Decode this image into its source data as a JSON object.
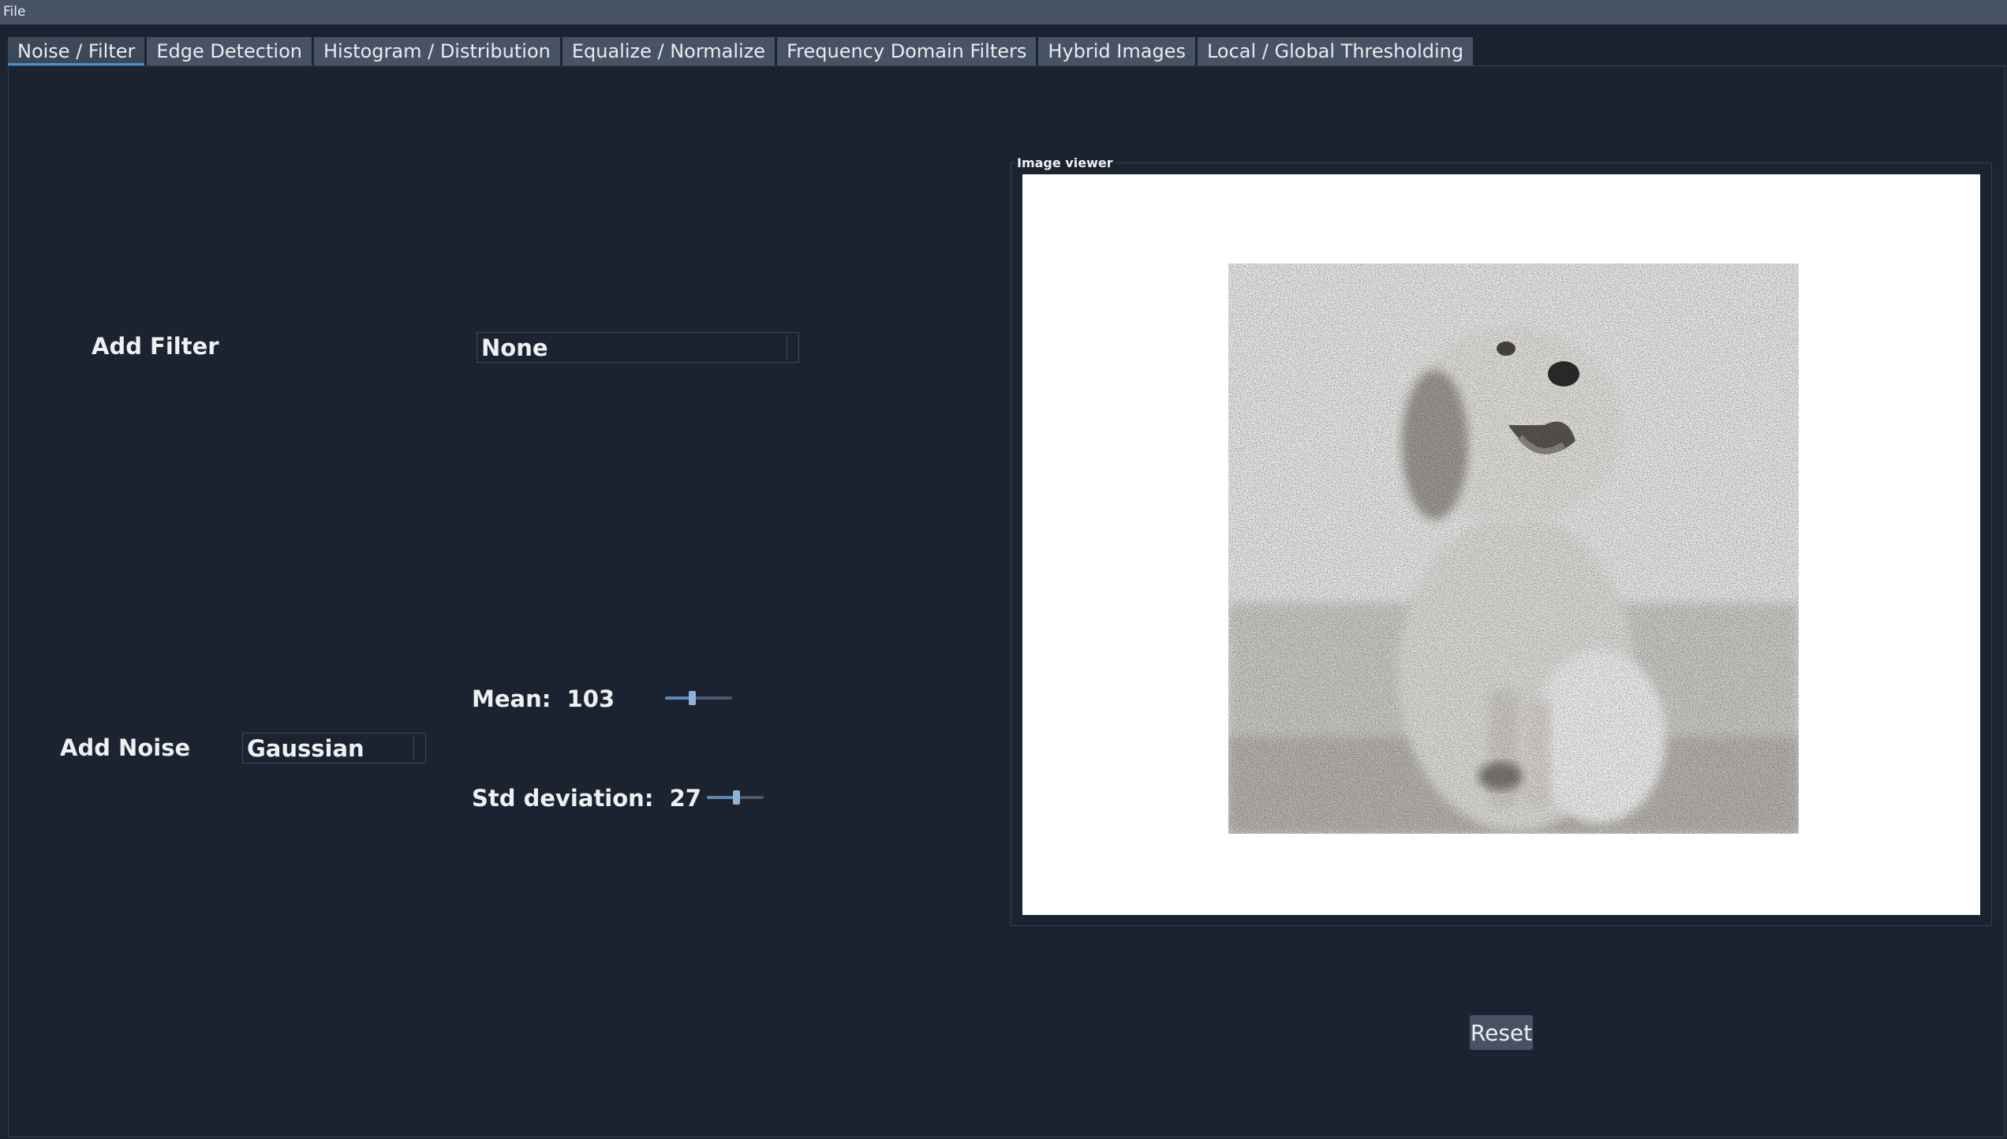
{
  "menubar": {
    "file_label": "File"
  },
  "tabs": [
    {
      "label": "Noise / Filter",
      "active": true
    },
    {
      "label": "Edge Detection",
      "active": false
    },
    {
      "label": "Histogram / Distribution",
      "active": false
    },
    {
      "label": "Equalize / Normalize",
      "active": false
    },
    {
      "label": "Frequency Domain Filters",
      "active": false
    },
    {
      "label": "Hybrid Images",
      "active": false
    },
    {
      "label": "Local / Global Thresholding",
      "active": false
    }
  ],
  "filter": {
    "label": "Add Filter",
    "selected": "None"
  },
  "noise": {
    "label": "Add Noise",
    "selected": "Gaussian",
    "mean_label": "Mean:",
    "mean_value": "103",
    "mean_fraction": 0.4,
    "std_label": "Std deviation:",
    "std_value": "27",
    "std_fraction": 0.52
  },
  "viewer": {
    "title": "Image viewer",
    "image_subject": "grayscale photo of a puppy sitting in grass with gaussian noise"
  },
  "reset_label": "Reset",
  "colors": {
    "background": "#1b2330",
    "bar": "#475365",
    "accent": "#4a90d0"
  }
}
